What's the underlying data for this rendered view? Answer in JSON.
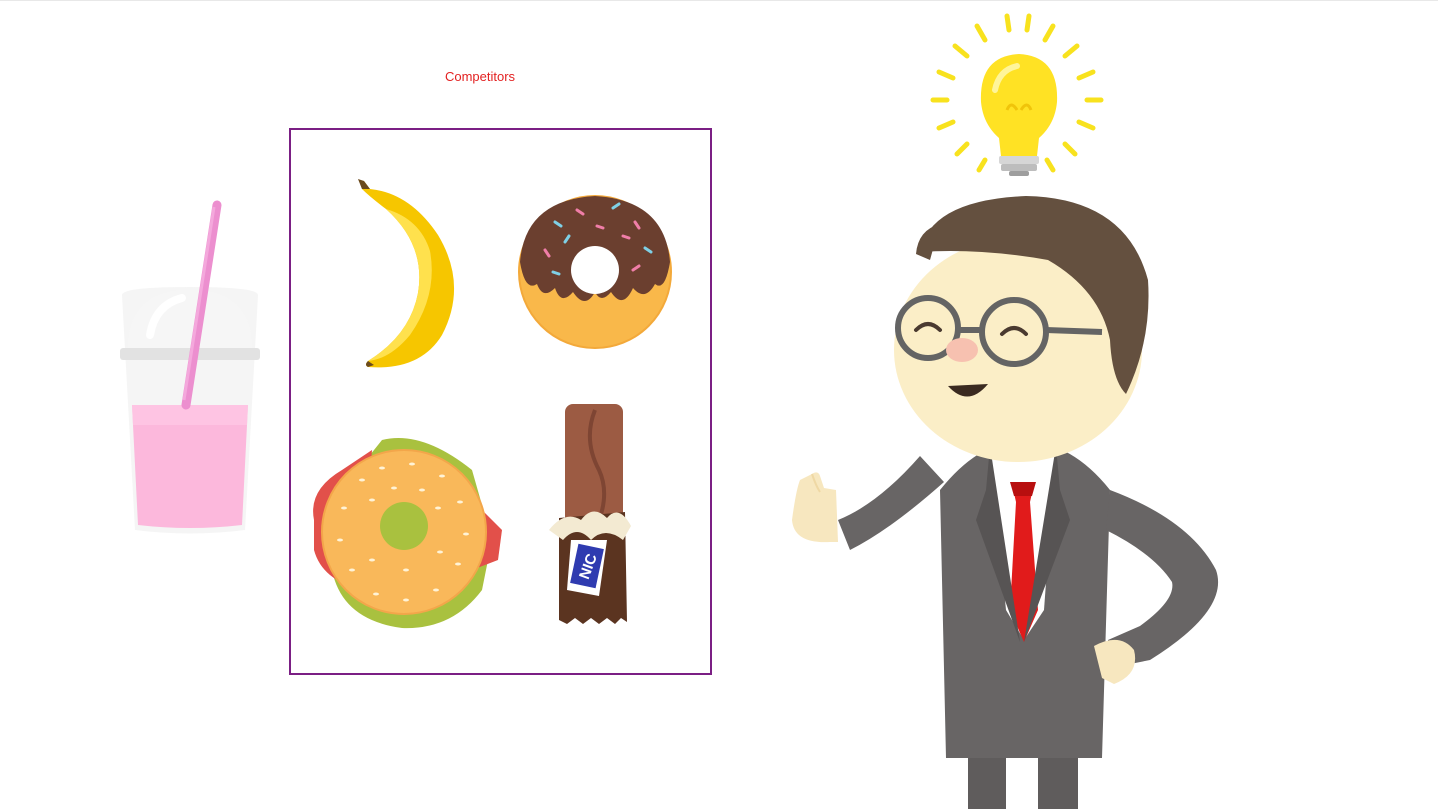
{
  "title": "Competitors",
  "frame_color": "#7b1f84",
  "title_color": "#e32222",
  "icons": {
    "smoothie": "smoothie-cup-icon",
    "banana": "banana-icon",
    "donut": "donut-icon",
    "bagel": "bagel-sandwich-icon",
    "candy": "candy-bar-icon",
    "bulb": "lightbulb-icon",
    "person": "businessman-illustration"
  },
  "candy_wrapper_text": "NIC"
}
